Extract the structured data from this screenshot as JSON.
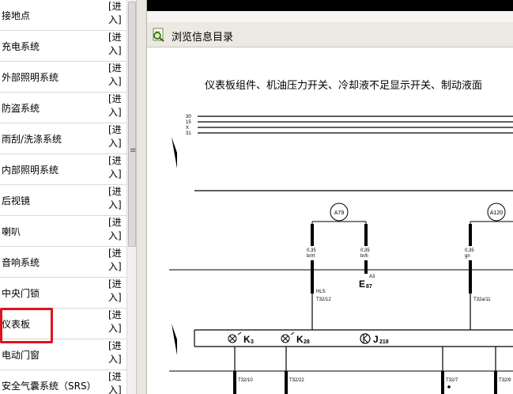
{
  "nav": {
    "enter_label_top": "[进",
    "enter_label_bottom": "入]",
    "items": [
      {
        "label": "接地点"
      },
      {
        "label": "充电系统"
      },
      {
        "label": "外部照明系统"
      },
      {
        "label": "防盗系统"
      },
      {
        "label": "雨刮/洗涤系统"
      },
      {
        "label": "内部照明系统"
      },
      {
        "label": "后视镜"
      },
      {
        "label": "喇叭"
      },
      {
        "label": "音响系统"
      },
      {
        "label": "中央门锁"
      },
      {
        "label": "仪表板"
      },
      {
        "label": "电动门窗"
      },
      {
        "label": "安全气囊系统（SRS）"
      }
    ],
    "highlighted_item": "仪表板",
    "highlight_color": "#e0121b"
  },
  "toolbar": {
    "title": "浏览信息目录",
    "icon": "magnifier-document-icon"
  },
  "document": {
    "title": "仪表板组件、机油压力开关、冷却液不足显示开关、制动液面",
    "diagram": {
      "rail_labels": [
        "30",
        "15",
        "X",
        "31"
      ],
      "connectors": [
        "A79",
        "A120"
      ],
      "wires": [
        {
          "gauge": "0,35",
          "color": "br/rt"
        },
        {
          "gauge": "0,35",
          "color": "br/li"
        },
        {
          "gauge": "0,35",
          "color": "gn"
        }
      ],
      "component_e": "E",
      "component_e_sub": "87",
      "component_e_ref": "A3",
      "hls_label": "HLS",
      "pin_labels_upper": [
        "T32/12",
        "T32a/11"
      ],
      "components": [
        {
          "name": "K",
          "sub": "3"
        },
        {
          "name": "K",
          "sub": "28"
        },
        {
          "name": "J",
          "sub": "218"
        }
      ],
      "pin_labels_lower": [
        "T32/10",
        "T32/22",
        "T32/7",
        "T32/9"
      ]
    }
  }
}
